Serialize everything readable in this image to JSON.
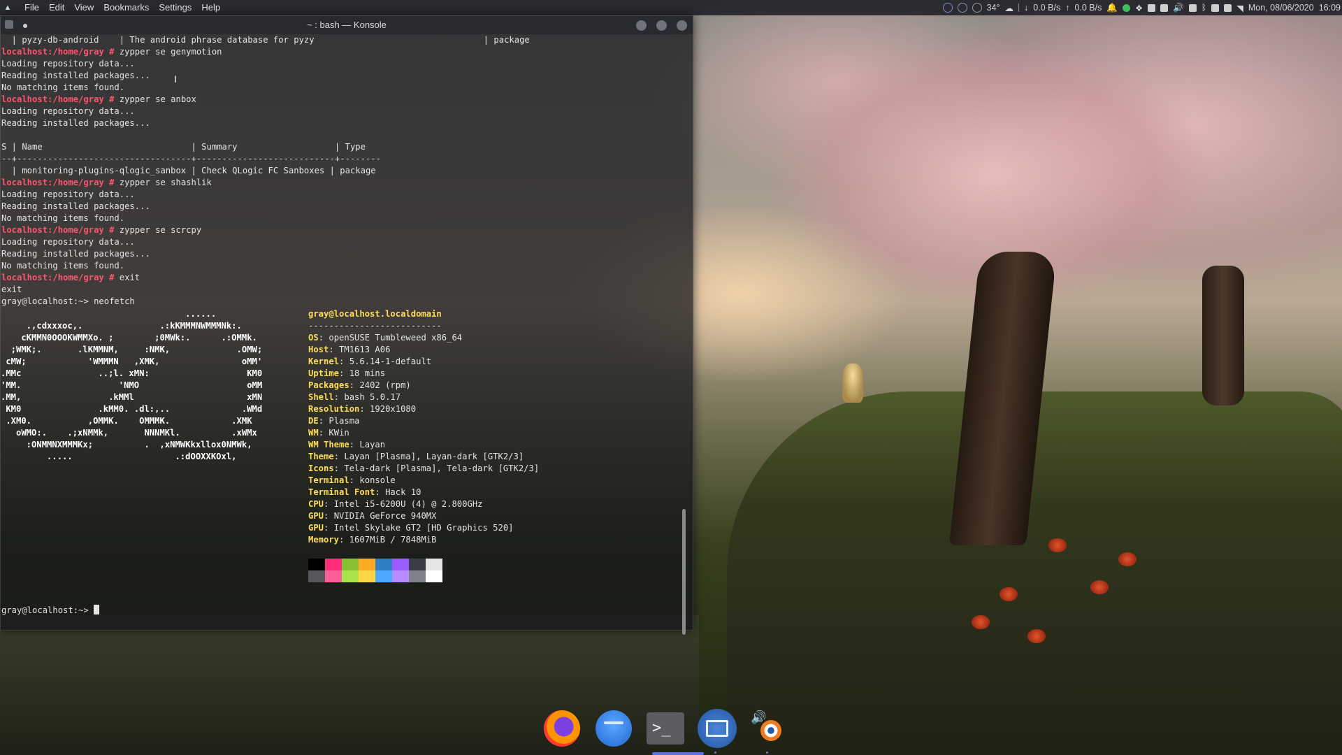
{
  "menu": {
    "items": [
      "File",
      "Edit",
      "View",
      "Bookmarks",
      "Settings",
      "Help"
    ]
  },
  "tray": {
    "temperature": "34°",
    "net_down": "0.0 B/s",
    "net_up": "0.0 B/s",
    "datetime": "Mon, 08/06/2020",
    "time": "16:09"
  },
  "window": {
    "title": "~ : bash — Konsole"
  },
  "terminal": {
    "lines": [
      {
        "p": "",
        "t": "  | pyzy-db-android    | The android phrase database for pyzy                                 | package"
      },
      {
        "p": "localhost:/home/gray #",
        "t": " zypper se genymotion"
      },
      {
        "p": "",
        "t": "Loading repository data..."
      },
      {
        "p": "",
        "t": "Reading installed packages..."
      },
      {
        "p": "",
        "t": "No matching items found."
      },
      {
        "p": "localhost:/home/gray #",
        "t": " zypper se anbox"
      },
      {
        "p": "",
        "t": "Loading repository data..."
      },
      {
        "p": "",
        "t": "Reading installed packages..."
      },
      {
        "p": "",
        "t": ""
      },
      {
        "p": "",
        "t": "S | Name                             | Summary                   | Type"
      },
      {
        "p": "",
        "t": "--+----------------------------------+---------------------------+--------"
      },
      {
        "p": "",
        "t": "  | monitoring-plugins-qlogic_sanbox | Check QLogic FC Sanboxes | package"
      },
      {
        "p": "localhost:/home/gray #",
        "t": " zypper se shashlik"
      },
      {
        "p": "",
        "t": "Loading repository data..."
      },
      {
        "p": "",
        "t": "Reading installed packages..."
      },
      {
        "p": "",
        "t": "No matching items found."
      },
      {
        "p": "localhost:/home/gray #",
        "t": " zypper se scrcpy"
      },
      {
        "p": "",
        "t": "Loading repository data..."
      },
      {
        "p": "",
        "t": "Reading installed packages..."
      },
      {
        "p": "",
        "t": "No matching items found."
      },
      {
        "p": "localhost:/home/gray #",
        "t": " exit"
      },
      {
        "p": "",
        "t": "exit"
      },
      {
        "p": "",
        "t": "gray@localhost:~> neofetch"
      }
    ],
    "ascii": [
      "                                    ......",
      "     .,cdxxxoc,.               .:kKMMMNWMMMNk:.",
      "    cKMMN0OOOKWMMXo. ;        ;0MWk:.      .:OMMk.",
      "  ;WMK;.       .lKMMNM,     :NMK,             .OMW;",
      " cMW;            'WMMMN   ,XMK,                oMM'",
      ".MMc               ..;l. xMN:                   KM0",
      "'MM.                   'NMO                     oMM",
      ".MM,                 .kMMl                      xMN",
      " KM0               .kMM0. .dl:,..              .WMd",
      " .XM0.           ,OMMK.    OMMMK.            .XMK",
      "   oWMO:.    .;xNMMk,       NNNMKl.          .xWMx",
      "     :ONMMNXMMMKx;          .  ,xNMWKkxllox0NMWk,",
      "         .....                    .:dOOXXKOxl,"
    ],
    "info_header": "gray@localhost.localdomain",
    "info_sep": "--------------------------",
    "info": [
      {
        "k": "OS",
        "v": "openSUSE Tumbleweed x86_64"
      },
      {
        "k": "Host",
        "v": "TM1613 A06"
      },
      {
        "k": "Kernel",
        "v": "5.6.14-1-default"
      },
      {
        "k": "Uptime",
        "v": "18 mins"
      },
      {
        "k": "Packages",
        "v": "2402 (rpm)"
      },
      {
        "k": "Shell",
        "v": "bash 5.0.17"
      },
      {
        "k": "Resolution",
        "v": "1920x1080"
      },
      {
        "k": "DE",
        "v": "Plasma"
      },
      {
        "k": "WM",
        "v": "KWin"
      },
      {
        "k": "WM Theme",
        "v": "Layan"
      },
      {
        "k": "Theme",
        "v": "Layan [Plasma], Layan-dark [GTK2/3]"
      },
      {
        "k": "Icons",
        "v": "Tela-dark [Plasma], Tela-dark [GTK2/3]"
      },
      {
        "k": "Terminal",
        "v": "konsole"
      },
      {
        "k": "Terminal Font",
        "v": "Hack 10"
      },
      {
        "k": "CPU",
        "v": "Intel i5-6200U (4) @ 2.800GHz"
      },
      {
        "k": "GPU",
        "v": "NVIDIA GeForce 940MX"
      },
      {
        "k": "GPU",
        "v": "Intel Skylake GT2 [HD Graphics 520]"
      },
      {
        "k": "Memory",
        "v": "1607MiB / 7848MiB"
      }
    ],
    "palette_top": [
      "#000000",
      "#ff2d7a",
      "#86c232",
      "#ffaa22",
      "#2e7fc6",
      "#9b5cff",
      "#3a3d44",
      "#e6e6e6"
    ],
    "palette_bottom": [
      "#56585c",
      "#ff5d9a",
      "#a6e24a",
      "#ffd445",
      "#4aa8ff",
      "#b78aff",
      "#7d828a",
      "#ffffff"
    ],
    "final_prompt": "gray@localhost:~> "
  },
  "dock": {
    "items": [
      {
        "name": "firefox",
        "icon": "firefox-icon"
      },
      {
        "name": "dolphin",
        "icon": "folder-icon"
      },
      {
        "name": "konsole",
        "icon": "terminal-icon"
      },
      {
        "name": "remote-desktop",
        "icon": "remote-desktop-icon"
      },
      {
        "name": "blender",
        "icon": "blender-icon"
      }
    ],
    "terminal_glyph": ">_"
  },
  "colors": {
    "prompt": "#ff5470",
    "info_key": "#ffdd55",
    "accent": "#5c72e8"
  }
}
